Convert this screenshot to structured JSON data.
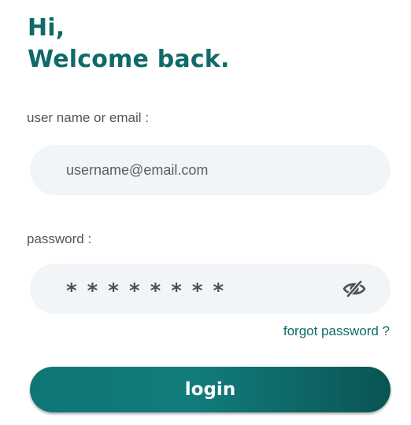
{
  "greeting": {
    "line1": "Hi,",
    "line2": "Welcome back."
  },
  "username": {
    "label": "user name or email :",
    "placeholder": "username@email.com",
    "value": ""
  },
  "password": {
    "label": "password :",
    "masked_value": "* * * * * * * *",
    "toggle_icon": "eye-slash-icon"
  },
  "forgot_link": "forgot password ?",
  "login_button": "login",
  "colors": {
    "accent": "#0f6a68",
    "field_background": "#f2f5f8",
    "label_text": "#555555",
    "button_gradient_start": "#0f7576",
    "button_gradient_end": "#0a5553"
  }
}
